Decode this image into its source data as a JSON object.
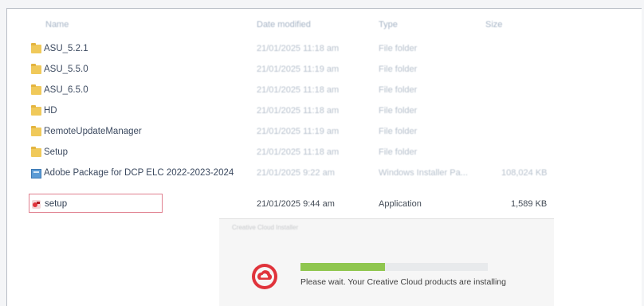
{
  "headers": {
    "name": "Name",
    "date_modified": "Date modified",
    "type": "Type",
    "size": "Size"
  },
  "files": [
    {
      "name": "ASU_5.2.1",
      "date": "21/01/2025 11:18 am",
      "type": "File folder",
      "size": "",
      "icon": "folder-icon"
    },
    {
      "name": "ASU_5.5.0",
      "date": "21/01/2025 11:19 am",
      "type": "File folder",
      "size": "",
      "icon": "folder-icon"
    },
    {
      "name": "ASU_6.5.0",
      "date": "21/01/2025 11:18 am",
      "type": "File folder",
      "size": "",
      "icon": "folder-icon"
    },
    {
      "name": "HD",
      "date": "21/01/2025 11:18 am",
      "type": "File folder",
      "size": "",
      "icon": "folder-icon"
    },
    {
      "name": "RemoteUpdateManager",
      "date": "21/01/2025 11:19 am",
      "type": "File folder",
      "size": "",
      "icon": "folder-icon"
    },
    {
      "name": "Setup",
      "date": "21/01/2025 11:18 am",
      "type": "File folder",
      "size": "",
      "icon": "folder-icon"
    },
    {
      "name": "Adobe Package for DCP ELC 2022-2023-2024",
      "date": "21/01/2025 9:22 am",
      "type": "Windows Installer Pa...",
      "size": "108,024 KB",
      "icon": "installer-icon"
    },
    {
      "name": "setup",
      "date": "21/01/2025 9:44 am",
      "type": "Application",
      "size": "1,589 KB",
      "icon": "app-icon"
    }
  ],
  "installer_popup": {
    "header": "Creative Cloud Installer",
    "message": "Please wait. Your Creative Cloud products are installing",
    "progress": 0.45
  },
  "colors": {
    "highlight_border": "#e0808f",
    "progress_fill": "#8fc64f",
    "adobe_red": "#e0333b"
  }
}
